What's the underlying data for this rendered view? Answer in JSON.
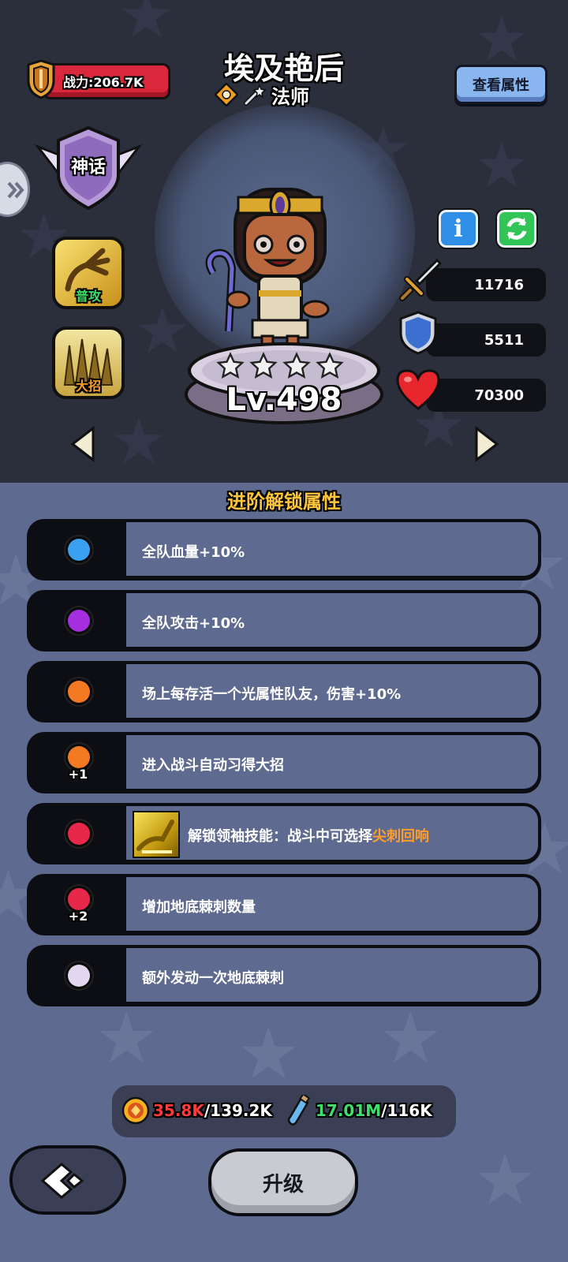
{
  "hero": {
    "power_label": "战力:206.7K",
    "name": "埃及艳后",
    "class": "法师",
    "rarity": "神话",
    "level": "Lv.498",
    "stars": 4
  },
  "buttons": {
    "view_attributes": "查看属性",
    "upgrade": "升级"
  },
  "skills": [
    {
      "label": "普攻",
      "label_color": "#3ee06a"
    },
    {
      "label": "大招",
      "label_color": "#ff9d2b"
    }
  ],
  "stats": {
    "attack": "11716",
    "defense": "5511",
    "hp": "70300"
  },
  "section_title": "进阶解锁属性",
  "unlocks": [
    {
      "dot_color": "#3aa0f0",
      "text": "全队血量+10%",
      "plus": ""
    },
    {
      "dot_color": "#a42ee0",
      "text": "全队攻击+10%",
      "plus": ""
    },
    {
      "dot_color": "#f37a22",
      "text": "场上每存活一个光属性队友，伤害+10%",
      "plus": ""
    },
    {
      "dot_color": "#f37a22",
      "text": "进入战斗自动习得大招",
      "plus": "+1"
    },
    {
      "dot_color": "#e8284a",
      "text": "解锁领袖技能：战斗中可选择",
      "highlight": "尖刺回响",
      "plus": ""
    },
    {
      "dot_color": "#e8284a",
      "text": "增加地底棘刺数量",
      "plus": "+2"
    },
    {
      "dot_color": "#e2d7ee",
      "text": "额外发动一次地底棘刺",
      "plus": ""
    }
  ],
  "resources": {
    "gold_have": "35.8K",
    "gold_need": "/139.2K",
    "potion_have": "17.01M",
    "potion_need": "/116K",
    "gold_have_color": "#ff3a3a",
    "potion_have_color": "#3ee06a"
  },
  "icons": {
    "power": "shield-crest-icon",
    "class": "wand-icon",
    "element": "light-element-icon",
    "attack": "sword-icon",
    "defense": "shield-icon",
    "hp": "heart-icon",
    "info": "info-icon",
    "refresh": "refresh-icon",
    "gold": "gold-coin-icon",
    "potion": "potion-icon",
    "back": "back-arrow-icon"
  }
}
